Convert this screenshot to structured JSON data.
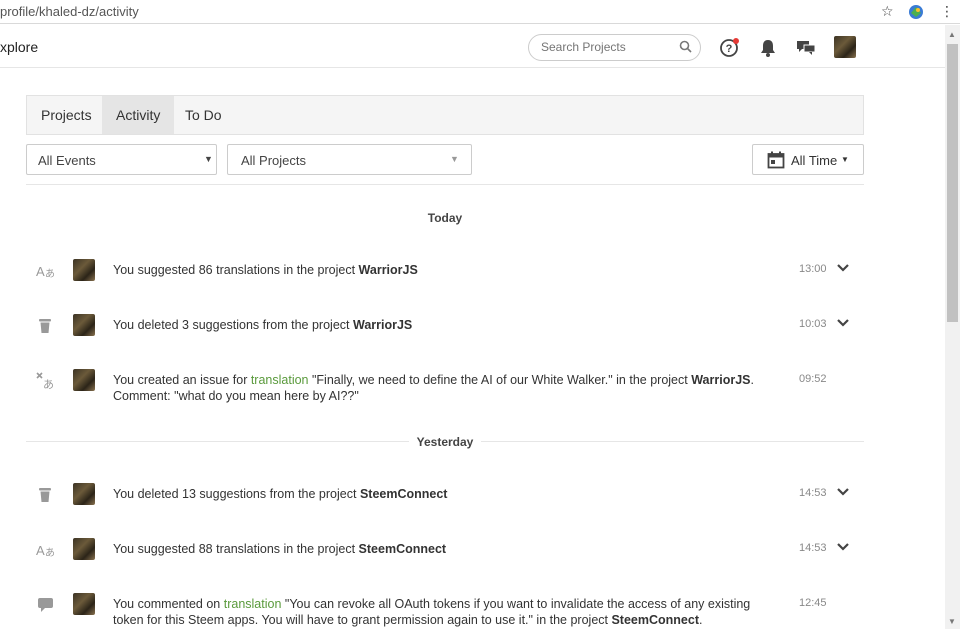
{
  "browser": {
    "url": "profile/khaled-dz/activity"
  },
  "header": {
    "explore_label": "xplore",
    "search_placeholder": "Search Projects"
  },
  "tabs": [
    {
      "label": "Projects",
      "active": false
    },
    {
      "label": "Activity",
      "active": true
    },
    {
      "label": "To Do",
      "active": false
    }
  ],
  "filters": {
    "events": "All Events",
    "projects": "All Projects",
    "time": "All Time"
  },
  "groups": {
    "today": "Today",
    "yesterday": "Yesterday"
  },
  "activities": [
    {
      "icon": "translate-icon",
      "pre": "You suggested 86 translations in the project ",
      "link": "",
      "mid": "",
      "project": "WarriorJS",
      "post": "",
      "time": "13:00",
      "expandable": true
    },
    {
      "icon": "trash-icon",
      "pre": "You deleted 3 suggestions from the project ",
      "link": "",
      "mid": "",
      "project": "WarriorJS",
      "post": "",
      "time": "10:03",
      "expandable": true
    },
    {
      "icon": "issue-icon",
      "pre": "You created an issue for ",
      "link": "translation",
      "mid": " \"Finally, we need to define the AI of our White Walker.\" in the project ",
      "project": "WarriorJS",
      "post": ". Comment: \"what do you mean here by AI??\"",
      "time": "09:52",
      "expandable": false
    },
    {
      "icon": "trash-icon",
      "pre": "You deleted 13 suggestions from the project ",
      "link": "",
      "mid": "",
      "project": "SteemConnect",
      "post": "",
      "time": "14:53",
      "expandable": true
    },
    {
      "icon": "translate-icon",
      "pre": "You suggested 88 translations in the project ",
      "link": "",
      "mid": "",
      "project": "SteemConnect",
      "post": "",
      "time": "14:53",
      "expandable": true
    },
    {
      "icon": "comment-icon",
      "pre": "You commented on ",
      "link": "translation",
      "mid": " \"You can revoke all OAuth tokens if you want to invalidate the access of any existing token for this Steem apps. You will have to grant permission again to use it.\" in the project ",
      "project": "SteemConnect",
      "post": ".",
      "time": "12:45",
      "expandable": false
    }
  ],
  "colors": {
    "link": "#5a9a3c",
    "notification_dot": "#e53935"
  }
}
